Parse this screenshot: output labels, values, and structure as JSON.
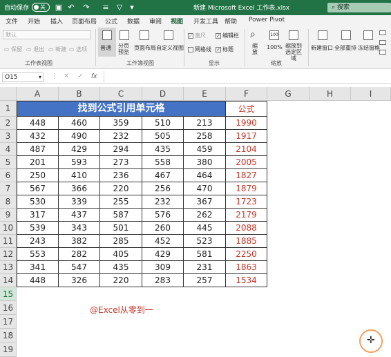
{
  "titlebar": {
    "autosave_label": "自动保存",
    "autosave_state": "关",
    "file_title": "新建 Microsoft Excel 工作表.xlsx",
    "search_placeholder": "搜索"
  },
  "tabs": [
    "文件",
    "开始",
    "插入",
    "页面布局",
    "公式",
    "数据",
    "审阅",
    "视图",
    "开发工具",
    "帮助",
    "Power Pivot"
  ],
  "active_tab": "视图",
  "ribbon": {
    "sheet_view": {
      "dropdown": "默认",
      "keep": "保留",
      "exit": "退出",
      "new": "新建",
      "options": "选项",
      "group": "工作表视图"
    },
    "workbook_views": {
      "normal": "普通",
      "page_break": "分页\n预览",
      "page_layout": "页面布局",
      "custom": "自定义视图",
      "group": "工作簿视图"
    },
    "show": {
      "ruler": "直尺",
      "formula_bar": "编辑栏",
      "gridlines": "网格线",
      "headings": "标题",
      "group": "显示"
    },
    "zoom": {
      "zoom": "缩\n放",
      "pct100": "100%",
      "zoom_sel": "缩放到\n选定区域",
      "group": "缩放"
    },
    "window": {
      "new_window": "新建窗口",
      "arrange": "全部重排",
      "freeze": "冻结窗格"
    }
  },
  "formula_bar": {
    "name_box": "O15",
    "fx": "fx"
  },
  "columns": [
    "A",
    "B",
    "C",
    "D",
    "E",
    "F",
    "G",
    "H",
    "I"
  ],
  "rows": [
    "1",
    "2",
    "3",
    "4",
    "5",
    "6",
    "7",
    "8",
    "9",
    "10",
    "11",
    "12",
    "13",
    "14",
    "15",
    "16",
    "17",
    "18",
    "19"
  ],
  "selected_row": "15",
  "sheet": {
    "title": "找到公式引用单元格",
    "formula_header": "公式",
    "data": [
      [
        "448",
        "460",
        "359",
        "510",
        "213",
        "1990"
      ],
      [
        "432",
        "490",
        "232",
        "505",
        "258",
        "1917"
      ],
      [
        "487",
        "429",
        "294",
        "435",
        "459",
        "2104"
      ],
      [
        "201",
        "593",
        "273",
        "558",
        "380",
        "2005"
      ],
      [
        "250",
        "410",
        "236",
        "467",
        "464",
        "1827"
      ],
      [
        "567",
        "366",
        "220",
        "256",
        "470",
        "1879"
      ],
      [
        "530",
        "339",
        "255",
        "232",
        "367",
        "1723"
      ],
      [
        "317",
        "437",
        "587",
        "576",
        "262",
        "2179"
      ],
      [
        "539",
        "343",
        "501",
        "260",
        "445",
        "2088"
      ],
      [
        "243",
        "382",
        "285",
        "452",
        "523",
        "1885"
      ],
      [
        "553",
        "282",
        "405",
        "429",
        "581",
        "2250"
      ],
      [
        "341",
        "547",
        "435",
        "309",
        "231",
        "1863"
      ],
      [
        "448",
        "326",
        "220",
        "283",
        "257",
        "1534"
      ]
    ]
  },
  "watermark": "@Excel从零到一"
}
